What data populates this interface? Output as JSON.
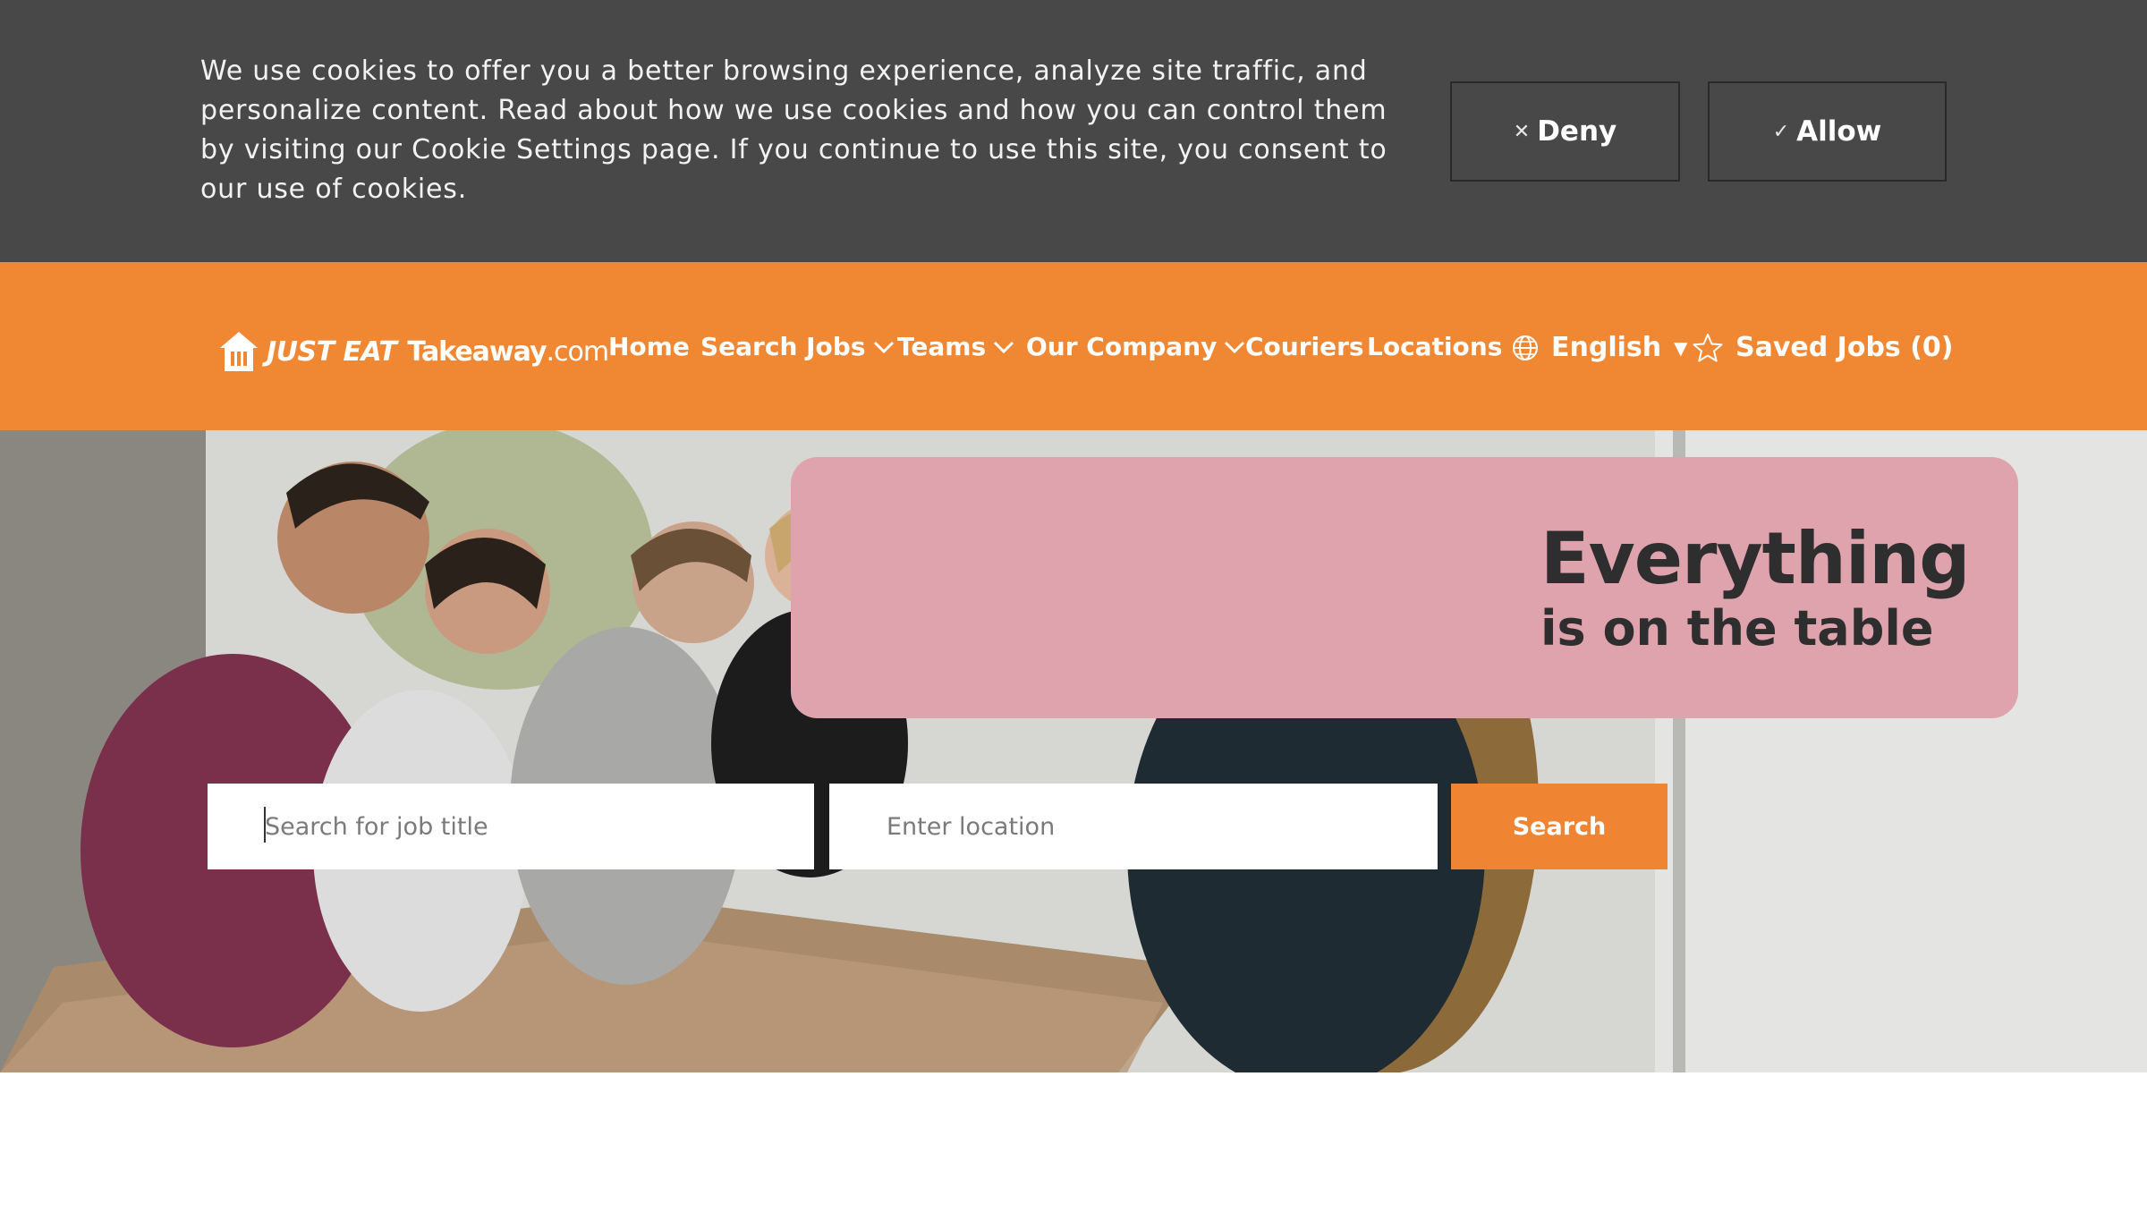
{
  "cookie_banner": {
    "text": "We use cookies to offer you a better browsing experience, analyze site traffic, and personalize content. Read about how we use cookies and how you can control them by visiting our Cookie Settings page. If you continue to use this site, you consent to our use of cookies.",
    "deny_label": "Deny",
    "allow_label": "Allow",
    "deny_icon": "close-icon",
    "allow_icon": "check-icon",
    "background_color": "#484848"
  },
  "nav": {
    "brand_color": "#f08833",
    "logo": {
      "part1": "JUST EAT",
      "part2": "Takeaway",
      "part3": ".com"
    },
    "links": [
      {
        "label": "Home",
        "has_dropdown": false
      },
      {
        "label": "Search Jobs",
        "has_dropdown": true
      },
      {
        "label": "Teams",
        "has_dropdown": true
      },
      {
        "label": "Our Company",
        "has_dropdown": true
      },
      {
        "label": "Couriers",
        "has_dropdown": false
      },
      {
        "label": "Locations",
        "has_dropdown": false
      }
    ],
    "language": {
      "selected": "English",
      "icon": "globe-icon"
    },
    "saved_jobs": {
      "label": "Saved Jobs (0)",
      "icon": "star-icon"
    }
  },
  "hero": {
    "tagline_line1": "Everything",
    "tagline_line2": "is on the table",
    "tagline_card_color": "#dea3ad",
    "search": {
      "job_placeholder": "Search for job title",
      "location_placeholder": "Enter location",
      "button_label": "Search",
      "button_color": "#ef8532"
    }
  }
}
